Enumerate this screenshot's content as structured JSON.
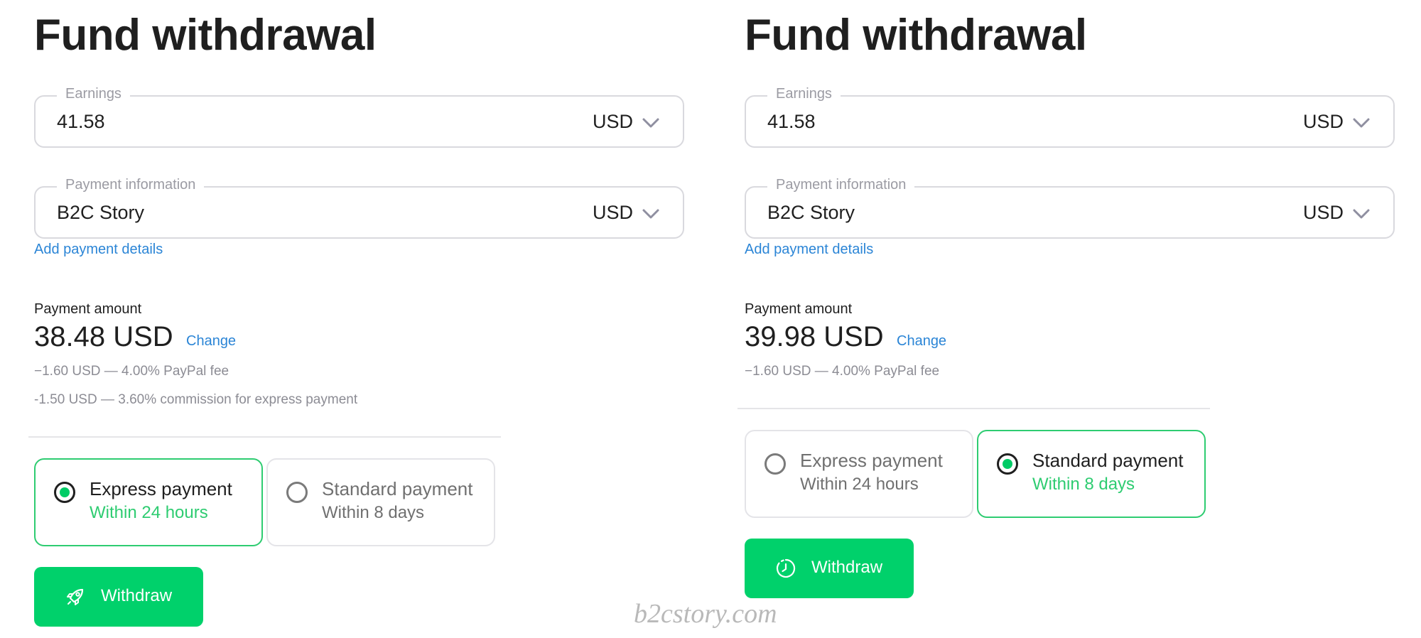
{
  "panels": [
    {
      "title": "Fund withdrawal",
      "earnings": {
        "label": "Earnings",
        "value": "41.58",
        "currency": "USD"
      },
      "payment_info": {
        "label": "Payment information",
        "value": "B2C Story",
        "currency": "USD"
      },
      "add_payment_details": "Add payment details",
      "payment_amount": {
        "label": "Payment amount",
        "value": "38.48 USD",
        "change": "Change",
        "fees": [
          "−1.60 USD — 4.00% PayPal fee",
          "-1.50 USD — 3.60% commission for express payment"
        ]
      },
      "options": [
        {
          "title": "Express payment",
          "subtitle": "Within 24 hours",
          "selected": true
        },
        {
          "title": "Standard payment",
          "subtitle": "Within 8 days",
          "selected": false
        }
      ],
      "button": {
        "label": "Withdraw",
        "icon": "rocket-icon"
      }
    },
    {
      "title": "Fund withdrawal",
      "earnings": {
        "label": "Earnings",
        "value": "41.58",
        "currency": "USD"
      },
      "payment_info": {
        "label": "Payment information",
        "value": "B2C Story",
        "currency": "USD"
      },
      "add_payment_details": "Add payment details",
      "payment_amount": {
        "label": "Payment amount",
        "value": "39.98 USD",
        "change": "Change",
        "fees": [
          "−1.60 USD — 4.00% PayPal fee"
        ]
      },
      "options": [
        {
          "title": "Express payment",
          "subtitle": "Within 24 hours",
          "selected": false
        },
        {
          "title": "Standard payment",
          "subtitle": "Within 8 days",
          "selected": true
        }
      ],
      "button": {
        "label": "Withdraw",
        "icon": "clock-icon"
      }
    }
  ],
  "watermark": "b2cstory.com",
  "colors": {
    "accent": "#00d16b",
    "link": "#2b85d6",
    "selected_text": "#2ecc71"
  }
}
